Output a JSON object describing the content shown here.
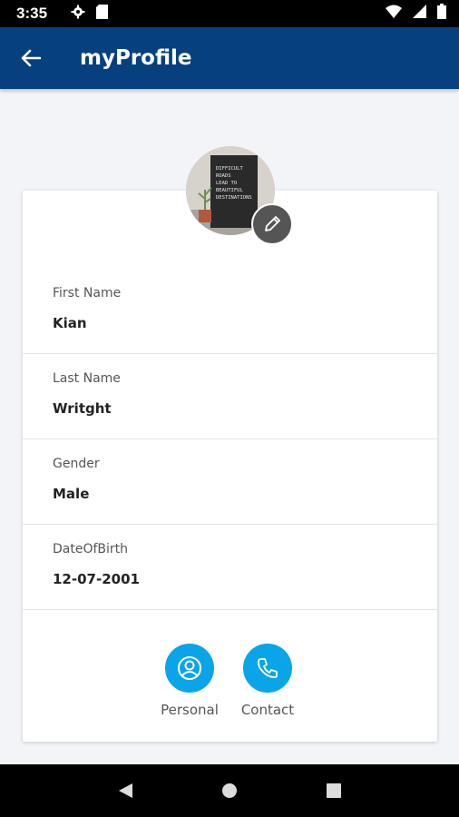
{
  "status_bar": {
    "time": "3:35",
    "icons": [
      "gear-icon",
      "sd-card-icon",
      "wifi-icon",
      "signal-icon",
      "battery-icon"
    ]
  },
  "app_bar": {
    "title": "myProfile",
    "back_icon": "arrow-left-icon",
    "color": "#07407f"
  },
  "profile": {
    "avatar_text_lines": [
      "DIFFICULT",
      "ROADS",
      "LEAD TO",
      "BEAUTIFUL",
      "DESTINATIONS"
    ],
    "fields": [
      {
        "label": "First Name",
        "value": "Kian"
      },
      {
        "label": "Last Name",
        "value": "Writght"
      },
      {
        "label": "Gender",
        "value": "Male"
      },
      {
        "label": "DateOfBirth",
        "value": "12-07-2001"
      }
    ]
  },
  "actions": [
    {
      "label": "Personal",
      "icon": "person-icon"
    },
    {
      "label": "Contact",
      "icon": "phone-icon"
    }
  ],
  "accent_color": "#0aa5e8",
  "nav_bar": {
    "icons": [
      "back-triangle-icon",
      "home-circle-icon",
      "recents-square-icon"
    ]
  }
}
